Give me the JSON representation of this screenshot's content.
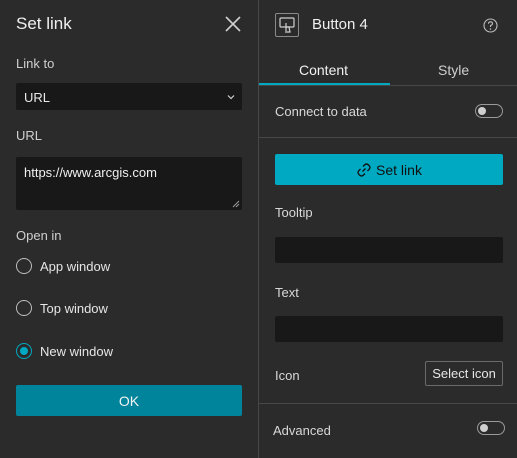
{
  "dialog": {
    "title": "Set link",
    "link_to_label": "Link to",
    "link_to_value": "URL",
    "url_label": "URL",
    "url_value": "https://www.arcgis.com",
    "open_in_label": "Open in",
    "open_in_options": [
      {
        "label": "App window",
        "checked": false
      },
      {
        "label": "Top window",
        "checked": false
      },
      {
        "label": "New window",
        "checked": true
      }
    ],
    "ok_label": "OK"
  },
  "panel": {
    "widget_title": "Button 4",
    "tabs": [
      {
        "label": "Content",
        "active": true
      },
      {
        "label": "Style",
        "active": false
      }
    ],
    "connect_to_data_label": "Connect to data",
    "set_link_label": "Set link",
    "tooltip_label": "Tooltip",
    "text_label": "Text",
    "icon_label": "Icon",
    "select_icon_label": "Select icon",
    "advanced_label": "Advanced"
  },
  "colors": {
    "accent": "#00a9c2",
    "ok_button": "#00849c",
    "background": "#2b2b2b",
    "field": "#181818"
  },
  "icons": {
    "close": "close-icon",
    "chevron": "chevron-down-icon",
    "widget": "touch-button-icon",
    "help": "help-icon",
    "link": "link-icon"
  }
}
